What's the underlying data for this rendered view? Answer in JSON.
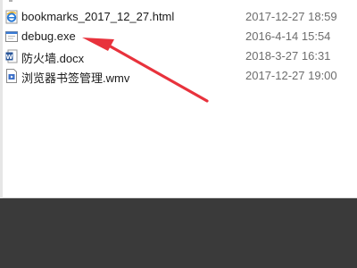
{
  "files": [
    {
      "name": "bookmarks_2017_12_27.html",
      "date": "2017-12-27 18:59",
      "icon": "ie-html-icon"
    },
    {
      "name": "debug.exe",
      "date": "2016-4-14 15:54",
      "icon": "exe-icon"
    },
    {
      "name": "防火墙.docx",
      "date": "2018-3-27 16:31",
      "icon": "word-doc-icon"
    },
    {
      "name": "浏览器书签管理.wmv",
      "date": "2017-12-27 19:00",
      "icon": "video-file-icon"
    }
  ],
  "annotation": {
    "arrow_color": "#e8323c",
    "points_to": "debug.exe"
  }
}
